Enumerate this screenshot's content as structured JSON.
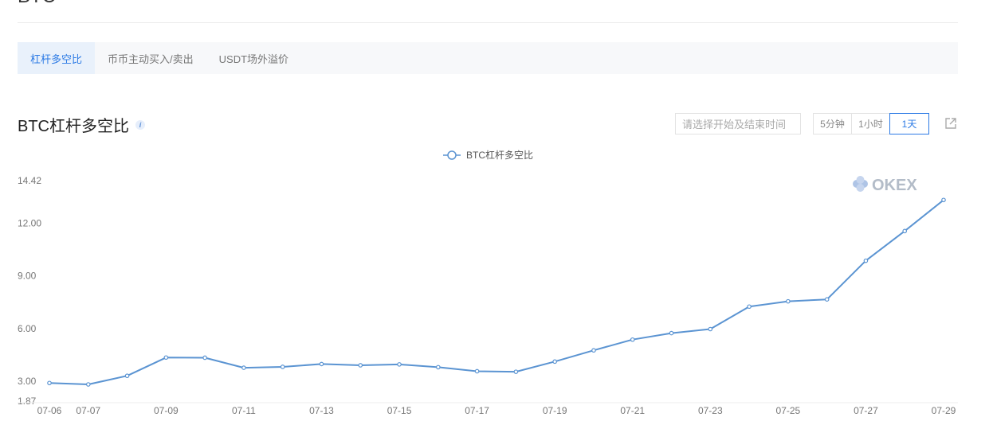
{
  "header": {
    "title_partial": "BTC"
  },
  "tabs": [
    {
      "label": "杠杆多空比",
      "active": true
    },
    {
      "label": "币币主动买入/卖出",
      "active": false
    },
    {
      "label": "USDT场外溢价",
      "active": false
    }
  ],
  "chart_header": {
    "title": "BTC杠杆多空比",
    "date_placeholder": "请选择开始及结束时间",
    "ranges": [
      {
        "label": "5分钟",
        "active": false
      },
      {
        "label": "1小时",
        "active": false
      },
      {
        "label": "1天",
        "active": true
      }
    ]
  },
  "brand": "OKEX",
  "colors": {
    "accent": "#2d7be5",
    "series": "#5b94d2",
    "brand_mark": "#aec4e6"
  },
  "chart_data": {
    "type": "line",
    "title": "BTC杠杆多空比",
    "series_name": "BTC杠杆多空比",
    "legend_position": "top-center",
    "grid": false,
    "ylim": [
      1.87,
      14.42
    ],
    "y_ticks": [
      "1.87",
      "3.00",
      "6.00",
      "9.00",
      "12.00",
      "14.42"
    ],
    "x_ticks": [
      "07-06",
      "07-07",
      "07-09",
      "07-11",
      "07-13",
      "07-15",
      "07-17",
      "07-19",
      "07-21",
      "07-23",
      "07-25",
      "07-27",
      "07-29"
    ],
    "x": [
      "07-06",
      "07-07",
      "07-08",
      "07-09",
      "07-10",
      "07-11",
      "07-12",
      "07-13",
      "07-14",
      "07-15",
      "07-16",
      "07-17",
      "07-18",
      "07-19",
      "07-20",
      "07-21",
      "07-22",
      "07-23",
      "07-24",
      "07-25",
      "07-26",
      "07-27",
      "07-28",
      "07-29"
    ],
    "values": [
      2.9,
      2.82,
      3.31,
      4.35,
      4.34,
      3.77,
      3.82,
      3.98,
      3.91,
      3.96,
      3.8,
      3.57,
      3.54,
      4.12,
      4.76,
      5.37,
      5.74,
      5.97,
      7.25,
      7.55,
      7.66,
      9.86,
      11.55,
      13.32
    ]
  }
}
